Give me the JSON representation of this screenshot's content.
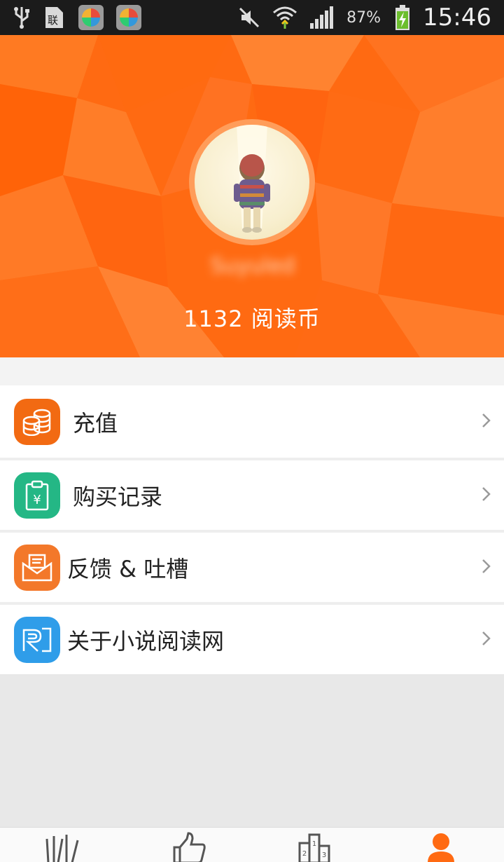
{
  "status_bar": {
    "battery_percent": "87%",
    "time": "15:46",
    "icons": [
      "usb-icon",
      "sim-icon",
      "app-icon",
      "app-icon",
      "mute-icon",
      "wifi-icon",
      "signal-icon",
      "battery-charging-icon"
    ]
  },
  "profile": {
    "username": "Suyuled",
    "coins_text": "1132  阅读币"
  },
  "menu": {
    "items": [
      {
        "label": "充值",
        "icon": "coins-icon",
        "color": "#f26a12"
      },
      {
        "label": "购买记录",
        "icon": "receipt-icon",
        "color": "#24b785"
      },
      {
        "label": "反馈 & 吐槽",
        "icon": "mail-icon",
        "color": "#f3782a"
      },
      {
        "label": "关于小说阅读网",
        "icon": "app-logo-icon",
        "color": "#2f9de9"
      }
    ]
  },
  "bottom_nav": {
    "tabs": [
      "bookshelf-icon",
      "recommend-icon",
      "ranking-icon",
      "profile-icon"
    ],
    "active_index": 3,
    "active_color": "#ff6a12"
  }
}
